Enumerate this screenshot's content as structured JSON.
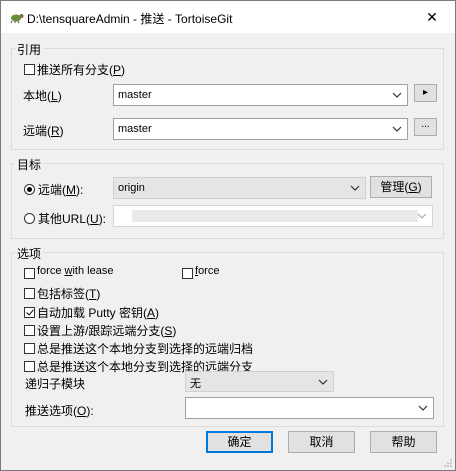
{
  "window": {
    "title": "D:\\tensquareAdmin - 推送 - TortoiseGit",
    "icon": "tortoisegit-icon",
    "close_glyph": "✕"
  },
  "ref_group": {
    "label": "引用",
    "push_all_branches": {
      "label": "推送所有分支(",
      "key": "P",
      "suffix": ")",
      "checked": false
    },
    "local": {
      "label": "本地(",
      "key": "L",
      "suffix": ")",
      "value": "master",
      "more_glyph": "▸"
    },
    "remote": {
      "label": "远端(",
      "key": "R",
      "suffix": ")",
      "value": "master",
      "more_glyph": "..."
    }
  },
  "target_group": {
    "label": "目标",
    "remote_radio": {
      "label": "远端(",
      "key": "M",
      "suffix": "):",
      "value": "origin",
      "selected": true
    },
    "manage_button": {
      "label": "管理(",
      "key": "G",
      "suffix": ")"
    },
    "other_url_radio": {
      "label": "其他URL(",
      "key": "U",
      "suffix": "):",
      "value": "",
      "selected": false
    }
  },
  "options_group": {
    "label": "选项",
    "force_with_lease": {
      "pre": "force ",
      "key": "w",
      "post": "ith lease",
      "checked": false
    },
    "force": {
      "pre": "",
      "key": "f",
      "post": "orce",
      "checked": false
    },
    "include_tags": {
      "label": "包括标签(",
      "key": "T",
      "suffix": ")",
      "checked": false
    },
    "autoload_putty": {
      "label": "自动加载 Putty 密钥(",
      "key": "A",
      "suffix": ")",
      "checked": true
    },
    "set_upstream": {
      "label": "设置上游/跟踪远端分支(",
      "key": "S",
      "suffix": ")",
      "checked": false
    },
    "always_push_archive": {
      "label": "总是推送这个本地分支到选择的远端归档",
      "checked": false
    },
    "always_push_branch": {
      "label": "总是推送这个本地分支到选择的远端分支",
      "checked": false
    },
    "recurse_submodules": {
      "label": "递归子模块",
      "value": "无"
    },
    "push_options": {
      "label": "推送选项(",
      "key": "O",
      "suffix": "):",
      "value": ""
    }
  },
  "buttons": {
    "ok": "确定",
    "cancel": "取消",
    "help": "帮助"
  }
}
